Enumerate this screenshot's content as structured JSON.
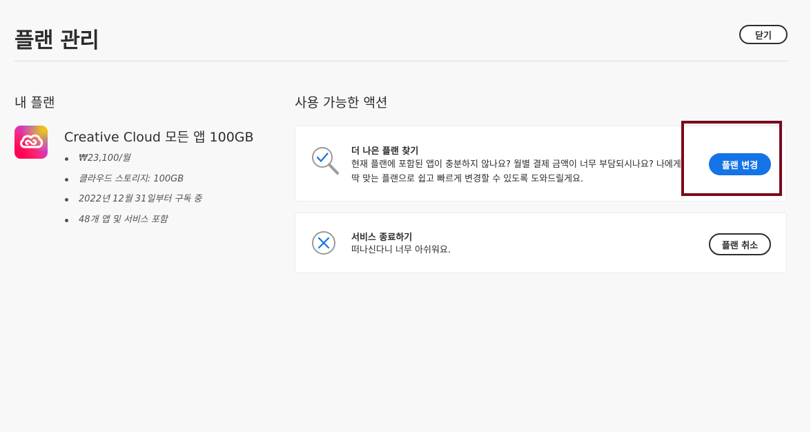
{
  "header": {
    "title": "플랜 관리",
    "close_label": "닫기"
  },
  "my_plan": {
    "section_title": "내 플랜",
    "app_icon": "creative-cloud-logo",
    "plan_name": "Creative Cloud 모든 앱 100GB",
    "details": [
      "₩23,100/월",
      "클라우드 스토리지: 100GB",
      "2022년 12월 31일부터 구독 중",
      "48개 앱 및 서비스 포함"
    ]
  },
  "actions": {
    "section_title": "사용 가능한 액션",
    "items": [
      {
        "icon": "magnifier-check-icon",
        "title": "더 나은 플랜 찾기",
        "description": "현재 플랜에 포함된 앱이 충분하지 않나요? 월별 결제 금액이 너무 부담되시나요? 나에게 딱 맞는 플랜으로 쉽고 빠르게 변경할 수 있도록 도와드릴게요.",
        "button_label": "플랜 변경"
      },
      {
        "icon": "circle-x-icon",
        "title": "서비스 종료하기",
        "description": "떠나신다니 너무 아쉬워요.",
        "button_label": "플랜 취소"
      }
    ]
  },
  "colors": {
    "primary_button": "#1473e6",
    "highlight": "#7a0a1c",
    "background": "#f8f8f8"
  }
}
